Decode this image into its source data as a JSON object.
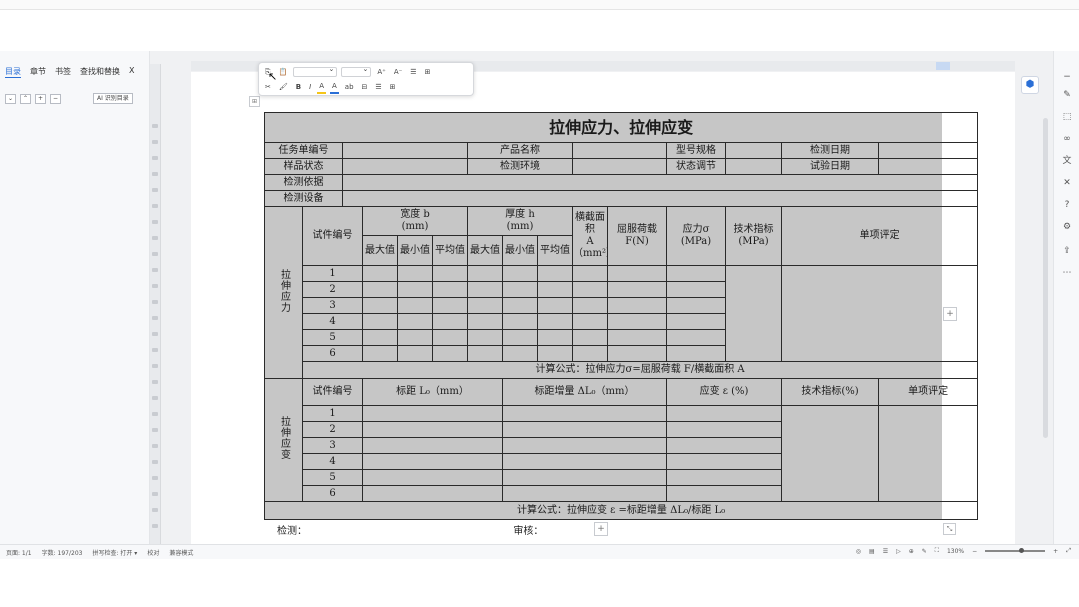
{
  "left_panel": {
    "tabs": [
      "目录",
      "章节",
      "书签",
      "查找和替换"
    ],
    "close": "X",
    "ai_button": "AI 识别目录"
  },
  "toolbar": {
    "row1": [
      "⎘",
      "📋",
      "A⁺",
      "A⁻",
      "☰",
      "⊞"
    ],
    "row2": [
      "✂",
      "🖌",
      "B",
      "I",
      "A",
      "A",
      "ab",
      "⊟",
      "☰",
      "⊞"
    ]
  },
  "document": {
    "title": "拉伸应力、拉伸应变",
    "header_rows": [
      [
        "任务单编号",
        "",
        "产品名称",
        "",
        "型号规格",
        "",
        "检测日期",
        ""
      ],
      [
        "样品状态",
        "",
        "检测环境",
        "",
        "状态调节",
        "",
        "试验日期",
        ""
      ]
    ],
    "basis_label": "检测依据",
    "equipment_label": "检测设备",
    "stress_section": {
      "side_label": "拉伸应力",
      "col_id": "试件编号",
      "width_label": "宽度 b",
      "width_unit": "(mm)",
      "thickness_label": "厚度 h",
      "thickness_unit": "(mm)",
      "sub_max": "最大值",
      "sub_min": "最小值",
      "sub_avg": "平均值",
      "area_label": "横截面积",
      "area_unit": "A（mm²）",
      "yield_label": "屈服荷载",
      "yield_unit": "F(N)",
      "stress_label": "应力σ",
      "stress_unit": "(MPa)",
      "tech_label": "技术指标(MPa)",
      "eval_label": "单项评定",
      "rows": [
        "1",
        "2",
        "3",
        "4",
        "5",
        "6"
      ],
      "formula": "计算公式：拉伸应力σ=屈服荷载 F/横截面积 A"
    },
    "strain_section": {
      "side_label": "拉伸应变",
      "col_id": "试件编号",
      "gauge_label": "标距 L₀（mm）",
      "delta_label": "标距增量 ΔL₀（mm）",
      "strain_label": "应变 ε (%)",
      "tech_label": "技术指标(%)",
      "eval_label": "单项评定",
      "rows": [
        "1",
        "2",
        "3",
        "4",
        "5",
        "6"
      ],
      "formula": "计算公式：拉伸应变 ε =标距增量 ΔL₀/标距 L₀"
    },
    "footer_check": "检测：",
    "footer_review": "审核："
  },
  "statusbar": {
    "left": [
      "页面: 1/1",
      "字数: 197/203",
      "拼写检查: 打开 ▾",
      "校对",
      "兼容模式"
    ],
    "zoom": "130%"
  },
  "colors": {
    "table_bg": "#c6c6c6",
    "accent": "#2b6fd6"
  }
}
